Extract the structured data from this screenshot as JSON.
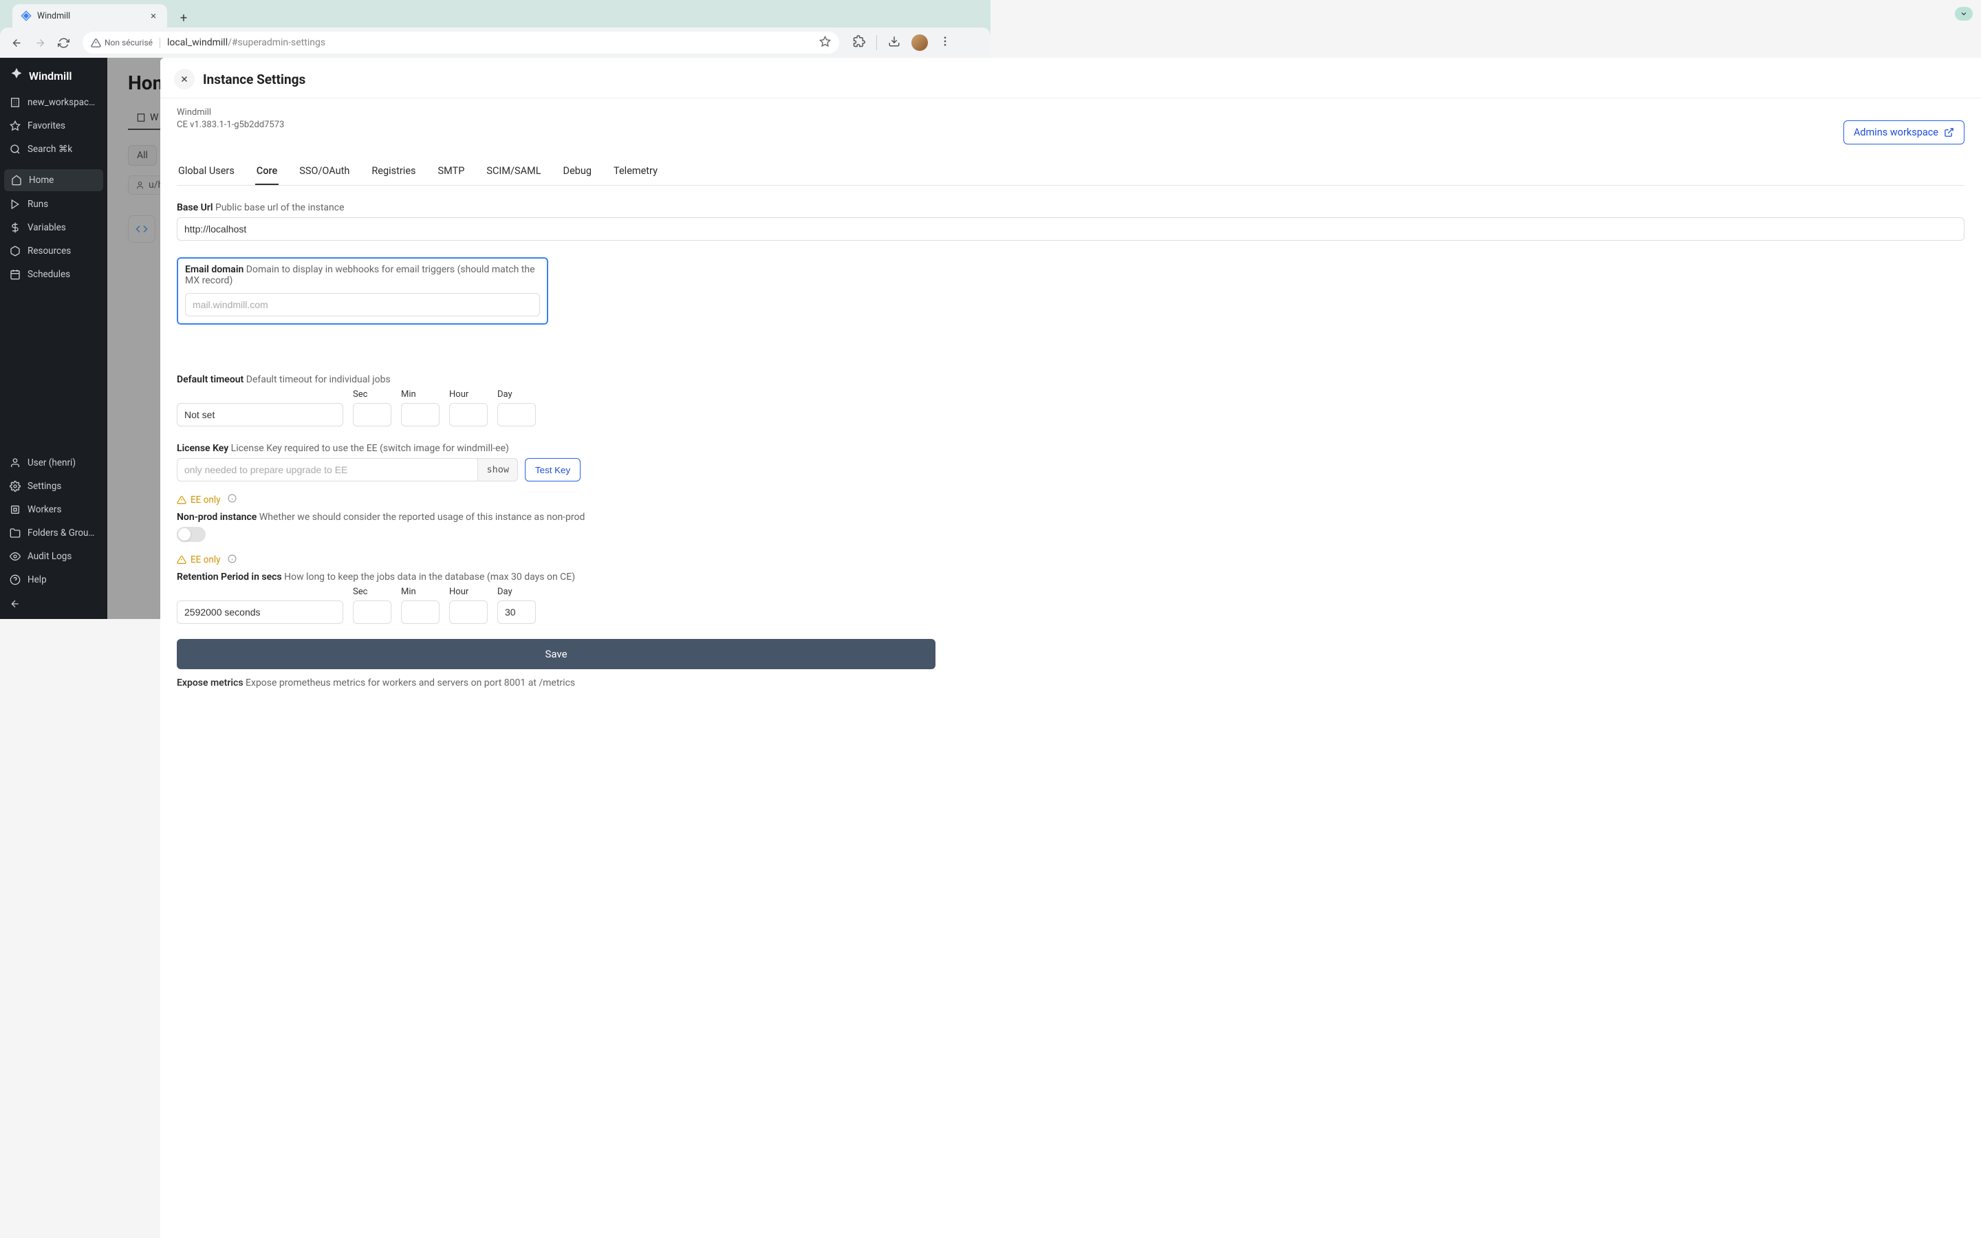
{
  "browser": {
    "tab_title": "Windmill",
    "insecure_label": "Non sécurisé",
    "url_host": "local_windmill",
    "url_path": "/#superadmin-settings"
  },
  "sidebar": {
    "logo": "Windmill",
    "items": [
      {
        "label": "new_workspace...",
        "icon": "workspace"
      },
      {
        "label": "Favorites",
        "icon": "star"
      },
      {
        "label": "Search   ⌘k",
        "icon": "search"
      },
      {
        "label": "Home",
        "icon": "home",
        "active": true
      },
      {
        "label": "Runs",
        "icon": "play"
      },
      {
        "label": "Variables",
        "icon": "dollar"
      },
      {
        "label": "Resources",
        "icon": "box"
      },
      {
        "label": "Schedules",
        "icon": "calendar"
      }
    ],
    "bottom_items": [
      {
        "label": "User (henri)",
        "icon": "user"
      },
      {
        "label": "Settings",
        "icon": "gear"
      },
      {
        "label": "Workers",
        "icon": "cpu"
      },
      {
        "label": "Folders & Groups...",
        "icon": "folder"
      },
      {
        "label": "Audit Logs",
        "icon": "eye"
      },
      {
        "label": "Help",
        "icon": "help"
      }
    ]
  },
  "backdrop": {
    "title": "Hom",
    "mini_tab": "W",
    "chip": "All",
    "user_chip": "u/h"
  },
  "panel": {
    "title": "Instance Settings",
    "meta1": "Windmill",
    "meta2": "CE v1.383.1-1-g5b2dd7573",
    "admins_label": "Admins workspace",
    "tabs": [
      "Global Users",
      "Core",
      "SSO/OAuth",
      "Registries",
      "SMTP",
      "SCIM/SAML",
      "Debug",
      "Telemetry"
    ],
    "active_tab": "Core",
    "base_url": {
      "label": "Base Url",
      "sub": "Public base url of the instance",
      "value": "http://localhost"
    },
    "email_domain": {
      "label": "Email domain",
      "sub": "Domain to display in webhooks for email triggers (should match the MX record)",
      "placeholder": "mail.windmill.com"
    },
    "timeout": {
      "label": "Default timeout",
      "sub": "Default timeout for individual jobs",
      "notset": "Not set",
      "sec": "Sec",
      "min": "Min",
      "hour": "Hour",
      "day": "Day"
    },
    "license": {
      "label": "License Key",
      "sub": "License Key required to use the EE (switch image for windmill-ee)",
      "placeholder": "only needed to prepare upgrade to EE",
      "show": "show",
      "test": "Test Key"
    },
    "ee_only": "EE only",
    "nonprod": {
      "label": "Non-prod instance",
      "sub": "Whether we should consider the reported usage of this instance as non-prod"
    },
    "retention": {
      "label": "Retention Period in secs",
      "sub": "How long to keep the jobs data in the database (max 30 days on CE)",
      "value": "2592000 seconds",
      "day": "30",
      "sec": "Sec",
      "min": "Min",
      "hour": "Hour",
      "daylabel": "Day"
    },
    "save": "Save",
    "expose": {
      "label": "Expose metrics",
      "sub": "Expose prometheus metrics for workers and servers on port 8001 at /metrics"
    }
  }
}
